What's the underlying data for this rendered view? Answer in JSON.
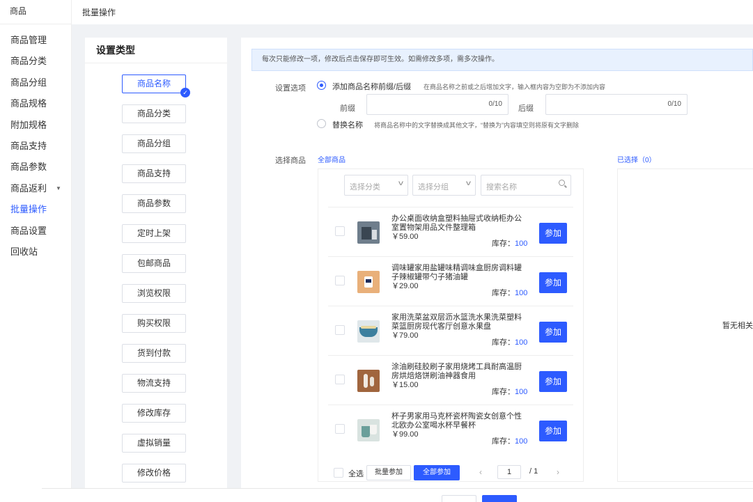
{
  "app": {
    "title": "商品"
  },
  "sidebar": {
    "items": [
      {
        "label": "商品管理"
      },
      {
        "label": "商品分类"
      },
      {
        "label": "商品分组"
      },
      {
        "label": "商品规格"
      },
      {
        "label": "附加规格"
      },
      {
        "label": "商品支持"
      },
      {
        "label": "商品参数"
      },
      {
        "label": "商品返利"
      },
      {
        "label": "批量操作"
      },
      {
        "label": "商品设置"
      },
      {
        "label": "回收站"
      }
    ],
    "active": "批量操作",
    "caret_icon": "▼"
  },
  "breadcrumb": "批量操作",
  "type_panel": {
    "title": "设置类型",
    "buttons": [
      "商品名称",
      "商品分类",
      "商品分组",
      "商品支持",
      "商品参数",
      "定时上架",
      "包邮商品",
      "浏览权限",
      "购买权限",
      "货到付款",
      "物流支持",
      "修改库存",
      "虚拟销量",
      "修改价格"
    ],
    "active": "商品名称",
    "check_icon": "✓"
  },
  "notice": "每次只能修改一项，修改后点击保存即可生效。如需修改多项，需多次操作。",
  "settings": {
    "label": "设置选项",
    "option1": {
      "label": "添加商品名称前缀/后缀",
      "hint": "在商品名称之前或之后增加文字，输入框内容为空即为不添加内容",
      "prefix_label": "前缀",
      "prefix_count": "0/10",
      "suffix_label": "后缀",
      "suffix_count": "0/10"
    },
    "option2": {
      "label": "替换名称",
      "hint": "将商品名称中的文字替换成其他文字，“替换为”内容填空则将原有文字删除"
    }
  },
  "goods": {
    "label": "选择商品",
    "all_link": "全部商品",
    "selected_link": "已选择（0）",
    "filter_category": "选择分类",
    "filter_group": "选择分组",
    "search_placeholder": "搜索名称",
    "stock_label": "库存：",
    "join_label": "参加",
    "items": [
      {
        "name": "办公桌面收纳盒塑料抽屉式收纳柜办公室置物架用品文件整理箱",
        "price": "￥59.00",
        "stock": "100",
        "thumb": "organizer-photo"
      },
      {
        "name": "调味罐家用盐罐味精调味盒厨房调料罐子辣椒罐带勺子猪油罐",
        "price": "￥29.00",
        "stock": "100",
        "thumb": "spice-jar-photo"
      },
      {
        "name": "家用洗菜盆双层沥水篮洗水果洗菜塑料菜篮厨房现代客厅创意水果盘",
        "price": "￥79.00",
        "stock": "100",
        "thumb": "basket-photo"
      },
      {
        "name": "涂油刷硅胶刷子家用烧烤工具耐高温厨房烘焙烙饼刷油神器食用",
        "price": "￥15.00",
        "stock": "100",
        "thumb": "brush-photo"
      },
      {
        "name": "杯子男家用马克杯瓷杯陶瓷女创意个性北欧办公室喝水杯早餐杯",
        "price": "￥99.00",
        "stock": "100",
        "thumb": "mug-photo"
      }
    ],
    "select_all": "全选",
    "batch_join": "批量参加",
    "join_all": "全部参加",
    "page_current": "1",
    "page_total": "/ 1",
    "prev_icon": "‹",
    "next_icon": "›",
    "empty_text": "暂无相关"
  }
}
